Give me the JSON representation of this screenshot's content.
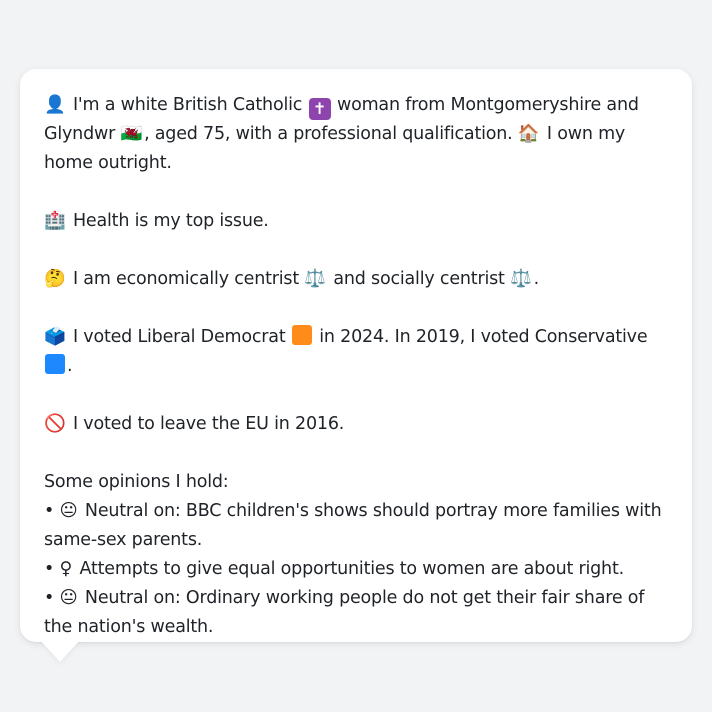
{
  "colors": {
    "page_bg": "#f1f3f5",
    "bubble_bg": "#ffffff",
    "text": "#1f2328",
    "libdem": "#ff8c1a",
    "conservative": "#1e88ff",
    "catholic_cross": "#8e44ad"
  },
  "profile": {
    "intro": {
      "person_icon": "👤",
      "p1": "I'm a white British Catholic",
      "cross_icon": "✝",
      "p2": "woman from Montgomeryshire and Glyndwr",
      "wales_flag_icon": "🏴󠁧󠁢󠁷󠁬󠁳󠁿",
      "p3": ", aged 75, with a professional qualification.",
      "house_icon": "🏠",
      "p4": "I own my home outright."
    },
    "health": {
      "icon": "🏥",
      "text": "Health is my top issue."
    },
    "politics": {
      "icon": "🤔",
      "p1": "I am economically centrist",
      "scale_icon": "⚖️",
      "p2": "and socially centrist",
      "scale_icon2": "⚖️",
      "p3": "."
    },
    "votes": {
      "icon": "🗳️",
      "p1": "I voted Liberal Democrat",
      "p2": "in 2024. In 2019, I voted Conservative",
      "p3": "."
    },
    "brexit": {
      "icon": "🚫",
      "text": "I voted to leave the EU in 2016."
    },
    "opinions": {
      "heading": "Some opinions I hold:",
      "items": [
        {
          "bullet": "•",
          "icon": "😐",
          "text": "Neutral on: BBC children's shows should portray more families with same-sex parents."
        },
        {
          "bullet": "•",
          "icon": "♀",
          "text": "Attempts to give equal opportunities to women are about right."
        },
        {
          "bullet": "•",
          "icon": "😐",
          "text": "Neutral on: Ordinary working people do not get their fair share of the nation's wealth."
        }
      ]
    }
  }
}
